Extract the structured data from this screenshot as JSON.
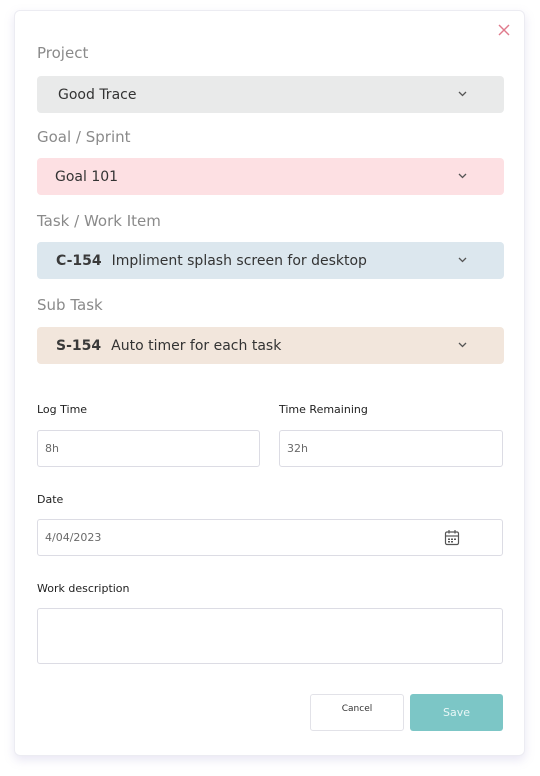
{
  "colors": {
    "project_bg": "#e9eaea",
    "goal_bg": "#fde0e3",
    "task_bg": "#dce7ee",
    "subtask_bg": "#f2e6dc",
    "save_bg": "#7cc6c6",
    "close_icon": "#e07a8c"
  },
  "icons": {
    "close": "close-icon",
    "chevron": "chevron-down-icon",
    "calendar": "calendar-icon"
  },
  "project": {
    "label": "Project",
    "value": "Good Trace"
  },
  "goal": {
    "label": "Goal / Sprint",
    "value": "Goal 101"
  },
  "task": {
    "label": "Task / Work Item",
    "code": "C-154",
    "value": "Impliment splash screen for desktop"
  },
  "subtask": {
    "label": "Sub Task",
    "code": "S-154",
    "value": "Auto timer for each task"
  },
  "log_time": {
    "label": "Log Time",
    "value": "8h"
  },
  "time_remaining": {
    "label": "Time Remaining",
    "value": "32h"
  },
  "date": {
    "label": "Date",
    "value": "4/04/2023"
  },
  "description": {
    "label": "Work description",
    "value": ""
  },
  "buttons": {
    "cancel": "Cancel",
    "save": "Save"
  }
}
